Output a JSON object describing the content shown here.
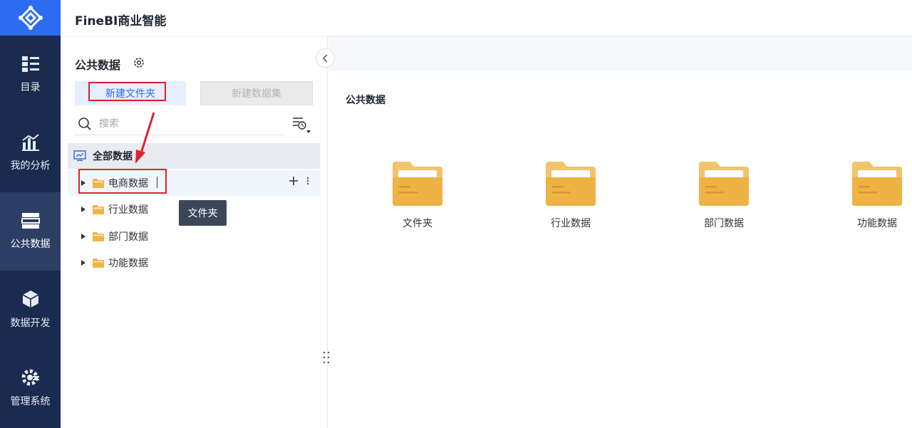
{
  "app": {
    "title": "FineBI商业智能"
  },
  "nav": {
    "items": [
      {
        "label": "目录",
        "icon": "catalog-icon"
      },
      {
        "label": "我的分析",
        "icon": "analysis-icon"
      },
      {
        "label": "公共数据",
        "icon": "public-data-icon",
        "active": true
      },
      {
        "label": "数据开发",
        "icon": "data-dev-icon"
      },
      {
        "label": "管理系统",
        "icon": "admin-icon"
      }
    ]
  },
  "panel": {
    "title": "公共数据",
    "new_folder_label": "新建文件夹",
    "new_dataset_label": "新建数据集",
    "search_placeholder": "搜索"
  },
  "tree": {
    "root_label": "全部数据",
    "items": [
      {
        "label": "电商数据",
        "selected": true
      },
      {
        "label": "行业数据"
      },
      {
        "label": "部门数据"
      },
      {
        "label": "功能数据"
      }
    ]
  },
  "tooltip": {
    "text": "文件夹"
  },
  "main": {
    "title": "公共数据",
    "folders": [
      {
        "label": "文件夹"
      },
      {
        "label": "行业数据"
      },
      {
        "label": "部门数据"
      },
      {
        "label": "功能数据"
      }
    ]
  },
  "colors": {
    "nav_bg": "#1b2b4f",
    "accent": "#2d6cf0",
    "folder": "#f1b348",
    "annotation_red": "#e0202d"
  }
}
